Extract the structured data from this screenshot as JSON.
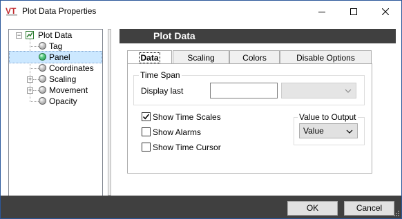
{
  "window": {
    "title": "Plot Data Properties"
  },
  "tree": {
    "root": "Plot Data",
    "items": [
      {
        "label": "Tag"
      },
      {
        "label": "Panel"
      },
      {
        "label": "Coordinates"
      },
      {
        "label": "Scaling"
      },
      {
        "label": "Movement"
      },
      {
        "label": "Opacity"
      }
    ],
    "selected": "Panel"
  },
  "panel": {
    "header": "Plot Data"
  },
  "tabs": [
    {
      "label": "Data",
      "active": true
    },
    {
      "label": "Scaling"
    },
    {
      "label": "Colors"
    },
    {
      "label": "Disable Options"
    }
  ],
  "time_span": {
    "legend": "Time Span",
    "display_last_label": "Display last",
    "display_last_value": "",
    "unit_value": ""
  },
  "options": {
    "show_time_scales": {
      "label": "Show Time Scales",
      "checked": true
    },
    "show_alarms": {
      "label": "Show Alarms",
      "checked": false
    },
    "show_time_cursor": {
      "label": "Show Time Cursor",
      "checked": false
    }
  },
  "value_to_output": {
    "legend": "Value to Output",
    "selected": "Value"
  },
  "buttons": {
    "ok": "OK",
    "cancel": "Cancel"
  },
  "icons": {
    "app": "vt-logo-icon",
    "minimize": "minimize-icon",
    "maximize": "maximize-icon",
    "close": "close-icon"
  },
  "colors": {
    "header_bg": "#404040",
    "bottombar_bg": "#404040",
    "selection": "#cce8ff",
    "logo_red": "#c0282d"
  }
}
